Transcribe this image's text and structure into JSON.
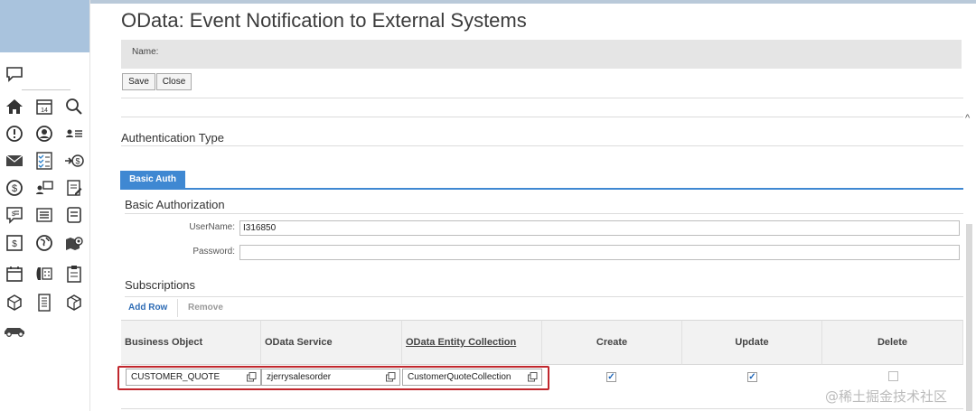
{
  "page": {
    "title": "OData: Event Notification to External Systems",
    "name_label": "Name:",
    "save_label": "Save",
    "close_label": "Close"
  },
  "auth": {
    "section_title": "Authentication Type",
    "tab_label": "Basic Auth",
    "subsection_title": "Basic Authorization",
    "username_label": "UserName:",
    "username_value": "I316850",
    "password_label": "Password:",
    "password_value": ""
  },
  "subscriptions": {
    "title": "Subscriptions",
    "add_row_label": "Add Row",
    "remove_label": "Remove",
    "columns": [
      "Business Object",
      "OData Service",
      "OData Entity Collection",
      "Create",
      "Update",
      "Delete"
    ],
    "rows": [
      {
        "business_object": "CUSTOMER_QUOTE",
        "odata_service": "zjerrysalesorder",
        "entity_collection": "CustomerQuoteCollection",
        "create": true,
        "update": true,
        "delete": false
      }
    ]
  },
  "colors": {
    "accent": "#3f88d2",
    "highlight": "#c0272d",
    "sidebar_header": "#a9c3dd"
  },
  "watermark": "@稀土掘金技术社区"
}
